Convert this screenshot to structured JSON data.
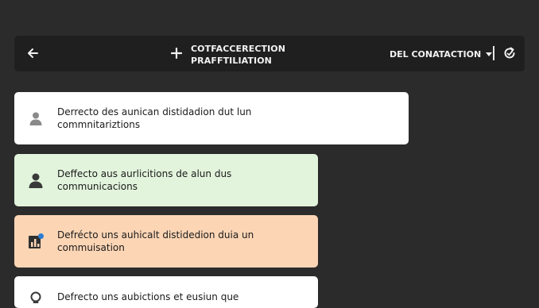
{
  "toolbar": {
    "title_line1": "COTFACCERECTION",
    "title_line2": "PRAFFTILIATION",
    "connection_label": "DEL CONATACTION",
    "icons": {
      "back": "arrow-left-icon",
      "add": "plus-icon",
      "dropdown": "caret-down-icon",
      "refresh": "refresh-icon"
    }
  },
  "cards": [
    {
      "line1": "Derrecto des aunican distidadion dut lun",
      "line2": "commnitariztions",
      "icon": "user-icon",
      "bg": "#ffffff"
    },
    {
      "line1": "Deffecto aus aurlicitions de alun dus",
      "line2": "communicacions",
      "icon": "user-icon",
      "bg": "#e2f4dc"
    },
    {
      "line1": "Defrécto uns auhicalt distidedion duia un",
      "line2": "commuisation",
      "icon": "report-icon",
      "bg": "#fcd5b5"
    },
    {
      "line1": "Defrecto uns aubictions et eusiun que",
      "line2": "",
      "icon": "lightbulb-icon",
      "bg": "#ffffff"
    }
  ]
}
